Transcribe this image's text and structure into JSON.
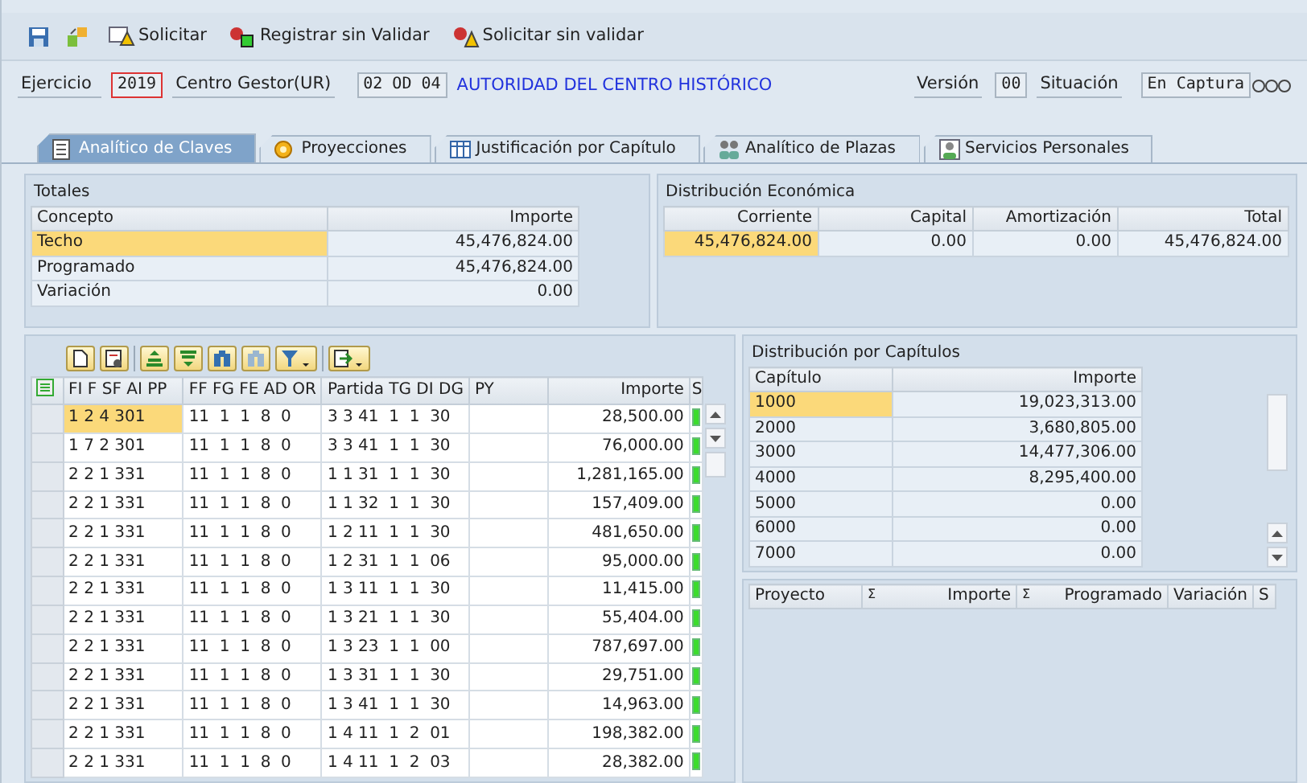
{
  "toolbar": {
    "buttons": [
      {
        "label": "Solicitar",
        "kind": "request"
      },
      {
        "label": "Registrar sin Validar",
        "kind": "register"
      },
      {
        "label": "Solicitar sin validar",
        "kind": "request_nv"
      }
    ]
  },
  "header": {
    "ejercicio_label": "Ejercicio",
    "ejercicio": "2019",
    "centro_label": "Centro Gestor(UR)",
    "centro": "02 OD 04",
    "centro_name": "AUTORIDAD DEL CENTRO HISTÓRICO",
    "version_label": "Versión",
    "version": "00",
    "situacion_label": "Situación",
    "situacion": "En Captura"
  },
  "tabs": [
    {
      "label": "Analítico de Claves",
      "kind": "list",
      "selected": true
    },
    {
      "label": "Proyecciones",
      "kind": "coin",
      "selected": false
    },
    {
      "label": "Justificación por Capítulo",
      "kind": "table",
      "selected": false
    },
    {
      "label": "Analítico de Plazas",
      "kind": "people",
      "selected": false
    },
    {
      "label": "Servicios Personales",
      "kind": "person",
      "selected": false
    }
  ],
  "totales": {
    "title": "Totales",
    "columns": [
      "Concepto",
      "Importe"
    ],
    "rows": [
      {
        "concepto": "Techo",
        "importe": "45,476,824.00",
        "selected": true
      },
      {
        "concepto": "Programado",
        "importe": "45,476,824.00",
        "selected": false
      },
      {
        "concepto": "Variación",
        "importe": "0.00",
        "selected": false
      }
    ]
  },
  "distribucion": {
    "title": "Distribución Económica",
    "columns": [
      "Corriente",
      "Capital",
      "Amortización",
      "Total"
    ],
    "cells": [
      {
        "text": "45,476,824.00",
        "selected": true
      },
      {
        "text": "0.00",
        "selected": false
      },
      {
        "text": "0.00",
        "selected": false
      },
      {
        "text": "45,476,824.00",
        "selected": false
      }
    ]
  },
  "grid": {
    "columns": [
      "FI F SF AI PP",
      "FF FG FE AD OR",
      "Partida TG DI DG",
      "PY",
      "Importe",
      "S"
    ],
    "rows": [
      {
        "cells": [
          "1 2 4 301",
          "11  1  1  8  0",
          "3 3 41  1  1  30",
          "",
          "28,500.00"
        ],
        "selected": true
      },
      {
        "cells": [
          "1 7 2 301",
          "11  1  1  8  0",
          "3 3 41  1  1  30",
          "",
          "76,000.00"
        ],
        "selected": false
      },
      {
        "cells": [
          "2 2 1 331",
          "11  1  1  8  0",
          "1 1 31  1  1  30",
          "",
          "1,281,165.00"
        ],
        "selected": false
      },
      {
        "cells": [
          "2 2 1 331",
          "11  1  1  8  0",
          "1 1 32  1  1  30",
          "",
          "157,409.00"
        ],
        "selected": false
      },
      {
        "cells": [
          "2 2 1 331",
          "11  1  1  8  0",
          "1 2 11  1  1  30",
          "",
          "481,650.00"
        ],
        "selected": false
      },
      {
        "cells": [
          "2 2 1 331",
          "11  1  1  8  0",
          "1 2 31  1  1  06",
          "",
          "95,000.00"
        ],
        "selected": false
      },
      {
        "cells": [
          "2 2 1 331",
          "11  1  1  8  0",
          "1 3 11  1  1  30",
          "",
          "11,415.00"
        ],
        "selected": false
      },
      {
        "cells": [
          "2 2 1 331",
          "11  1  1  8  0",
          "1 3 21  1  1  30",
          "",
          "55,404.00"
        ],
        "selected": false
      },
      {
        "cells": [
          "2 2 1 331",
          "11  1  1  8  0",
          "1 3 23  1  1  00",
          "",
          "787,697.00"
        ],
        "selected": false
      },
      {
        "cells": [
          "2 2 1 331",
          "11  1  1  8  0",
          "1 3 31  1  1  30",
          "",
          "29,751.00"
        ],
        "selected": false
      },
      {
        "cells": [
          "2 2 1 331",
          "11  1  1  8  0",
          "1 3 41  1  1  30",
          "",
          "14,963.00"
        ],
        "selected": false
      },
      {
        "cells": [
          "2 2 1 331",
          "11  1  1  8  0",
          "1 4 11  1  2  01",
          "",
          "198,382.00"
        ],
        "selected": false
      },
      {
        "cells": [
          "2 2 1 331",
          "11  1  1  8  0",
          "1 4 11  1  2  03",
          "",
          "28,382.00"
        ],
        "selected": false
      }
    ]
  },
  "capitulos": {
    "title": "Distribución por Capítulos",
    "columns": [
      "Capítulo",
      "Importe"
    ],
    "rows": [
      {
        "capitulo": "1000",
        "importe": "19,023,313.00",
        "selected": true
      },
      {
        "capitulo": "2000",
        "importe": "3,680,805.00",
        "selected": false
      },
      {
        "capitulo": "3000",
        "importe": "14,477,306.00",
        "selected": false
      },
      {
        "capitulo": "4000",
        "importe": "8,295,400.00",
        "selected": false
      },
      {
        "capitulo": "5000",
        "importe": "0.00",
        "selected": false
      },
      {
        "capitulo": "6000",
        "importe": "0.00",
        "selected": false
      },
      {
        "capitulo": "7000",
        "importe": "0.00",
        "selected": false
      }
    ]
  },
  "proyectos": {
    "columns": [
      {
        "label": "Proyecto"
      },
      {
        "mark": "Σ",
        "label": "Importe"
      },
      {
        "mark": "Σ",
        "label": "Programado"
      },
      {
        "label": "Variación"
      },
      {
        "label": "S"
      }
    ]
  }
}
